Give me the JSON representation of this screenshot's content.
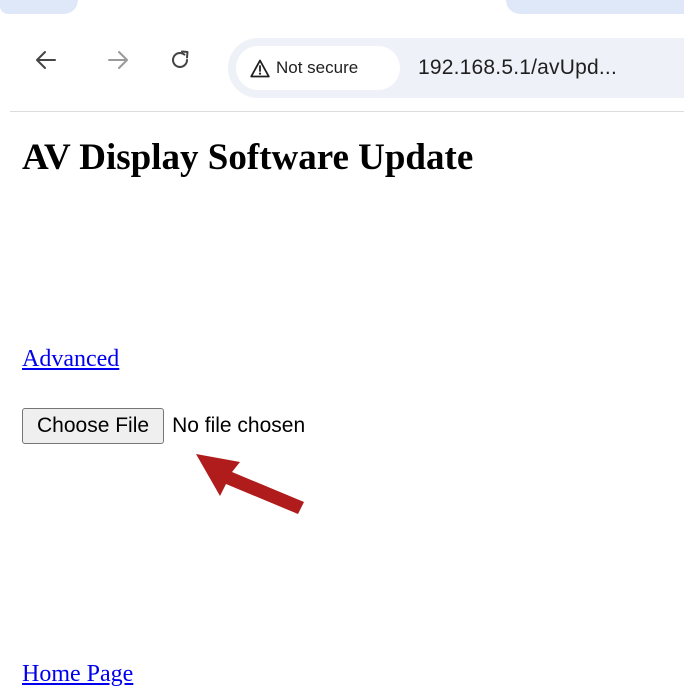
{
  "browser": {
    "security_label": "Not secure",
    "url": "192.168.5.1/avUpd..."
  },
  "page": {
    "title": "AV Display Software Update",
    "advanced_link": "Advanced",
    "choose_file_button": "Choose File",
    "file_status": "No file chosen",
    "home_link": "Home Page"
  },
  "icons": {
    "back": "back-arrow-icon",
    "forward": "forward-arrow-icon",
    "reload": "reload-icon",
    "warning": "warning-triangle-icon",
    "annotation": "red-arrow-annotation"
  },
  "colors": {
    "link": "#0000ee",
    "annotation_arrow": "#b01c1c",
    "omnibox_bg": "#eef1f7",
    "tab_strip_bg": "#dfe8f8"
  }
}
